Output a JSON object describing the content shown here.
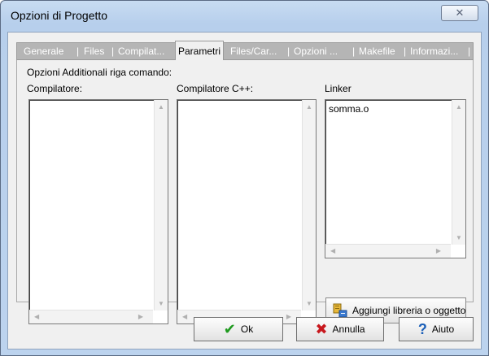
{
  "window": {
    "title": "Opzioni di Progetto"
  },
  "tabs": [
    {
      "label": "Generale",
      "active": false
    },
    {
      "label": "Files",
      "active": false
    },
    {
      "label": "Compilat...",
      "active": false
    },
    {
      "label": "Parametri",
      "active": true
    },
    {
      "label": "Files/Car...",
      "active": false
    },
    {
      "label": "Opzioni ...",
      "active": false
    },
    {
      "label": "Makefile",
      "active": false
    },
    {
      "label": "Informazi...",
      "active": false
    }
  ],
  "panel": {
    "caption": "Opzioni Additionali riga comando:",
    "columns": [
      {
        "label": "Compilatore:",
        "content": ""
      },
      {
        "label": "Compilatore C++:",
        "content": ""
      },
      {
        "label": "Linker",
        "content": "somma.o"
      }
    ],
    "add_button": "Aggiungi libreria o oggetto"
  },
  "buttons": {
    "ok": "Ok",
    "cancel": "Annulla",
    "help": "Aiuto"
  },
  "colors": {
    "ok_check": "#1f9a1f",
    "cancel_x": "#c8181e",
    "help_q": "#1b5fb8"
  }
}
